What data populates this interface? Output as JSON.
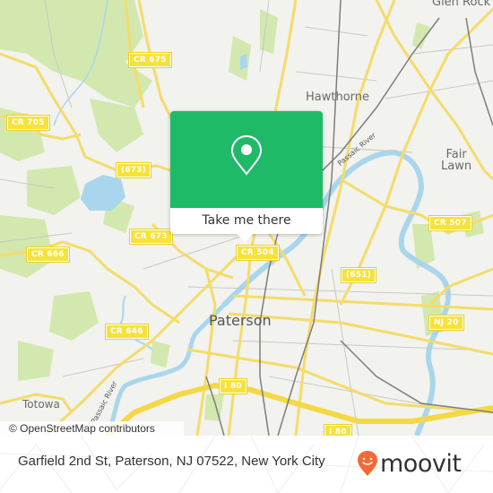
{
  "map": {
    "colors": {
      "land": "#f2f2ee",
      "park": "#cfe6a9",
      "water": "#a9d6ec",
      "road_major": "#f7e36a",
      "road_minor": "#c9c9c6",
      "rail": "#808080",
      "shield": "#f7e23a"
    },
    "road_shields": [
      {
        "id": "cr675",
        "label": "CR 675"
      },
      {
        "id": "cr705",
        "label": "CR 705"
      },
      {
        "id": "r673",
        "label": "(673)"
      },
      {
        "id": "cr673",
        "label": "CR 673"
      },
      {
        "id": "cr666",
        "label": "CR 666"
      },
      {
        "id": "cr504",
        "label": "CR 504"
      },
      {
        "id": "cr646",
        "label": "CR 646"
      },
      {
        "id": "r651",
        "label": "(651)"
      },
      {
        "id": "cr507",
        "label": "CR 507"
      },
      {
        "id": "nj20",
        "label": "NJ 20"
      },
      {
        "id": "i80a",
        "label": "I 80"
      },
      {
        "id": "i80b",
        "label": "I 80"
      }
    ],
    "places": {
      "glen_rock": "Glen Rock",
      "hawthorne": "Hawthorne",
      "fair_lawn_1": "Fair",
      "fair_lawn_2": "Lawn",
      "paterson": "Paterson",
      "totowa": "Totowa"
    },
    "rivers": {
      "passaic_north": "Passaic River",
      "passaic_south": "Passaic River"
    },
    "attribution": "© OpenStreetMap contributors"
  },
  "popup": {
    "icon": "location-pin-icon",
    "button_label": "Take me there",
    "accent": "#1fba68"
  },
  "footer": {
    "address": "Garfield 2nd St, Paterson, NJ 07522, New York City",
    "logo_text": "moovit",
    "logo_color": "#f26a36"
  }
}
